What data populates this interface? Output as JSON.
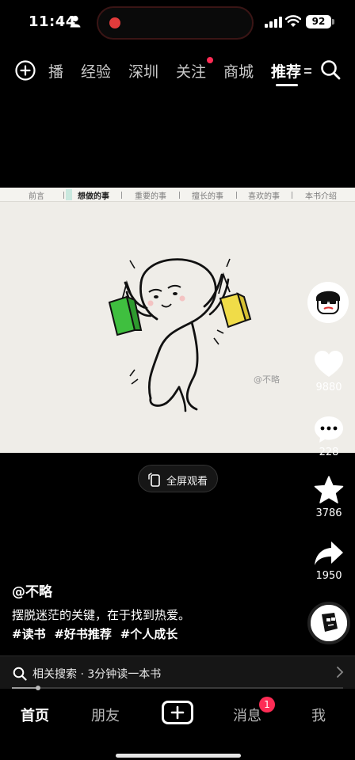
{
  "status_bar": {
    "time": "11:44",
    "battery": "92",
    "person_icon": "person-icon",
    "signal_icon": "cellular-signal-icon",
    "wifi_icon": "wifi-icon"
  },
  "top_nav": {
    "add_icon": "plus-circle-icon",
    "tabs": [
      {
        "label": "播"
      },
      {
        "label": "经验"
      },
      {
        "label": "深圳"
      },
      {
        "label": "关注"
      },
      {
        "label": "商城"
      },
      {
        "label": "推荐"
      }
    ],
    "active_tab": "推荐",
    "search_icon": "search-icon"
  },
  "video": {
    "chapters": [
      "前言",
      "想做的事",
      "重要的事",
      "擅长的事",
      "喜欢的事",
      "本书介绍"
    ],
    "current_chapter": "想做的事",
    "watermark": "@不略",
    "fullscreen_label": "全屏观看"
  },
  "actions": {
    "likes": "9880",
    "comments": "228",
    "favorites": "3786",
    "shares": "1950"
  },
  "post": {
    "author": "@不略",
    "caption": "摆脱迷茫的关键，在于找到热爱。",
    "hashtags": [
      "#读书",
      "#好书推荐",
      "#个人成长"
    ]
  },
  "related_search": {
    "text": "相关搜索 · 3分钟读一本书",
    "progress": 0.08
  },
  "bottom_nav": {
    "tabs": [
      "首页",
      "朋友",
      "消息",
      "我"
    ],
    "active": "首页",
    "message_badge": "1"
  },
  "colors": {
    "accent": "#fe2c55",
    "background": "#000000",
    "recording_dot": "#e23b3b"
  }
}
